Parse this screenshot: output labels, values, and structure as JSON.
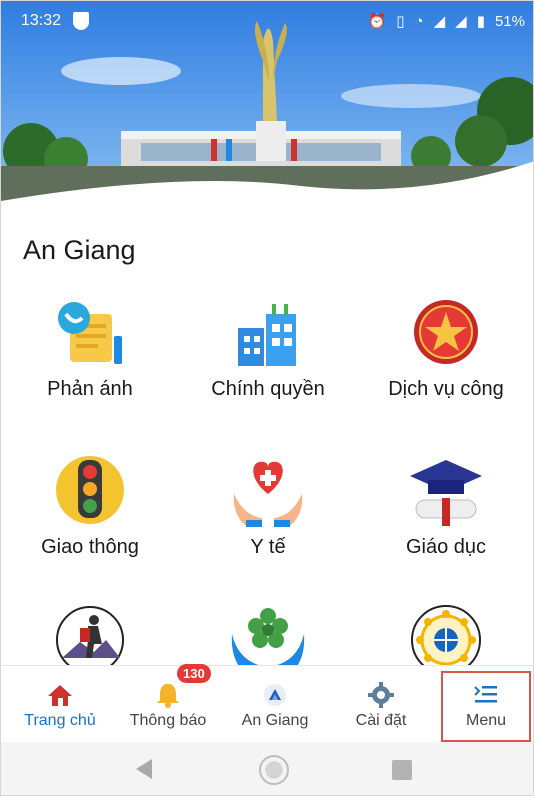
{
  "status_bar": {
    "time": "13:32",
    "battery": "51%",
    "icons": [
      "shield-icon",
      "alarm-icon",
      "vibrate-icon",
      "wifi-icon",
      "signal-icon",
      "signal-icon",
      "battery-icon"
    ]
  },
  "city": {
    "title": "An Giang"
  },
  "tiles": [
    {
      "label": "Phản ánh",
      "icon": "feedback-icon"
    },
    {
      "label": "Chính quyền",
      "icon": "government-building-icon"
    },
    {
      "label": "Dịch vụ công",
      "icon": "public-service-icon"
    },
    {
      "label": "Giao thông",
      "icon": "traffic-light-icon"
    },
    {
      "label": "Y tế",
      "icon": "health-icon"
    },
    {
      "label": "Giáo dục",
      "icon": "education-icon"
    },
    {
      "label": "",
      "icon": "tourism-icon"
    },
    {
      "label": "",
      "icon": "environment-icon"
    },
    {
      "label": "",
      "icon": "global-network-icon"
    }
  ],
  "bottom_nav": [
    {
      "label": "Trang chủ",
      "icon": "home-icon",
      "active": true
    },
    {
      "label": "Thông báo",
      "icon": "bell-icon",
      "badge": "130"
    },
    {
      "label": "An Giang",
      "icon": "logo-icon"
    },
    {
      "label": "Cài đặt",
      "icon": "gear-icon"
    },
    {
      "label": "Menu",
      "icon": "menu-icon"
    }
  ],
  "colors": {
    "active": "#1a73c7",
    "badge": "#e53935",
    "highlight_box": "#d9534f"
  }
}
